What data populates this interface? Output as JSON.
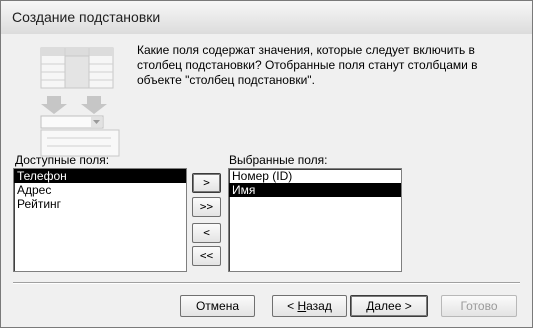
{
  "window": {
    "title": "Создание подстановки"
  },
  "prompt": "Какие поля содержат значения, которые следует включить в столбец подстановки? Отобранные поля станут столбцами в объекте \"столбец подстановки\".",
  "available": {
    "label": "Доступные поля:",
    "items": [
      "Телефон",
      "Адрес",
      "Рейтинг"
    ],
    "selected_index": 0
  },
  "chosen": {
    "label": "Выбранные поля:",
    "items": [
      "Номер (ID)",
      "Имя"
    ],
    "selected_index": 1
  },
  "transfer_buttons": {
    "add_one": ">",
    "add_all": ">>",
    "remove_one": "<",
    "remove_all": "<<"
  },
  "footer": {
    "cancel": "Отмена",
    "back_prefix": "< ",
    "back_mnemonic": "Н",
    "back_rest": "азад",
    "next_mnemonic": "Д",
    "next_rest": "алее >",
    "finish": "Готово"
  }
}
